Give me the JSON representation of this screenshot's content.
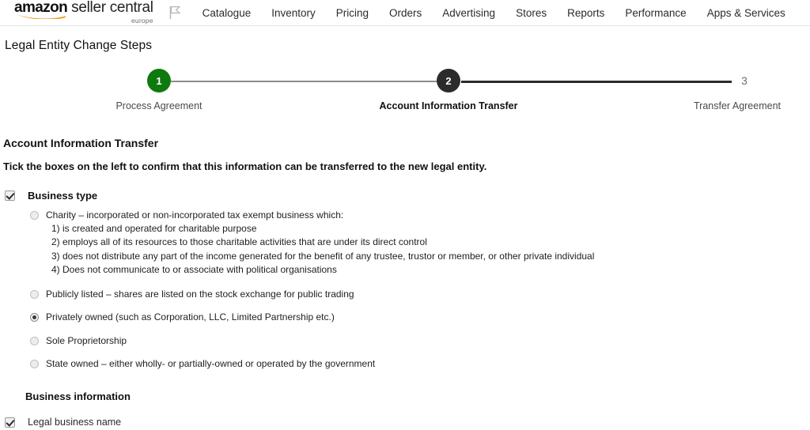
{
  "header": {
    "brand": {
      "amazon": "amazon",
      "seller_central": "seller central",
      "region": "europe",
      "flag_icon": "flag-icon"
    },
    "nav_items": [
      {
        "label": "Catalogue"
      },
      {
        "label": "Inventory"
      },
      {
        "label": "Pricing"
      },
      {
        "label": "Orders"
      },
      {
        "label": "Advertising"
      },
      {
        "label": "Stores"
      },
      {
        "label": "Reports"
      },
      {
        "label": "Performance"
      },
      {
        "label": "Apps & Services"
      }
    ]
  },
  "page": {
    "title": "Legal Entity Change Steps"
  },
  "stepper": {
    "steps": [
      {
        "number": "1",
        "label": "Process Agreement",
        "state": "complete",
        "color": "#0e7a0e"
      },
      {
        "number": "2",
        "label": "Account Information Transfer",
        "state": "current",
        "color": "#2b2b2b"
      },
      {
        "number": "3",
        "label": "Transfer Agreement",
        "state": "upcoming",
        "color": "#6e6e6e"
      }
    ]
  },
  "main": {
    "section_title": "Account Information Transfer",
    "instruction": "Tick the boxes on the left to confirm that this information can be transferred to the new legal entity.",
    "business_type": {
      "checkbox_checked": true,
      "label": "Business type",
      "options": [
        {
          "label": "Charity – incorporated or non-incorporated tax exempt business which:",
          "selected": false,
          "sublines": [
            "1) is created and operated for charitable purpose",
            "2) employs all of its resources to those charitable activities that are under its direct control",
            "3) does not distribute any part of the income generated for the benefit of any trustee, trustor or member, or other private individual",
            "4) Does not communicate to or associate with political organisations"
          ]
        },
        {
          "label": "Publicly listed – shares are listed on the stock exchange for public trading",
          "selected": false,
          "sublines": []
        },
        {
          "label": "Privately owned (such as Corporation, LLC, Limited Partnership etc.)",
          "selected": true,
          "sublines": []
        },
        {
          "label": "Sole Proprietorship",
          "selected": false,
          "sublines": []
        },
        {
          "label": "State owned – either wholly- or partially-owned or operated by the government",
          "selected": false,
          "sublines": []
        }
      ]
    },
    "business_information": {
      "title": "Business information",
      "fields": [
        {
          "label": "Legal business name",
          "checkbox_checked": true
        }
      ]
    }
  }
}
